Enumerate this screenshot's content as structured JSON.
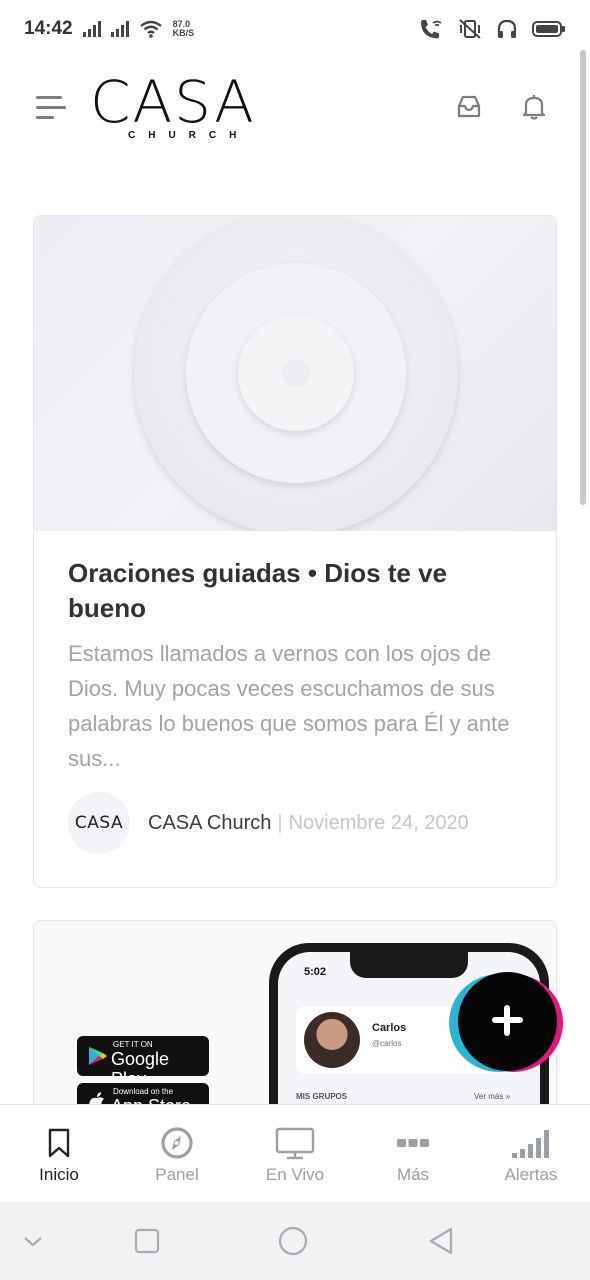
{
  "status_bar": {
    "time": "14:42",
    "net_speed_value": "87.0",
    "net_speed_unit": "KB/S"
  },
  "header": {
    "logo_main": "CASA",
    "logo_sub": "CHURCH",
    "menu_icon": "menu-icon",
    "inbox_icon": "inbox-icon",
    "notifications_icon": "bell-icon"
  },
  "feed": {
    "post": {
      "title": "Oraciones guiadas • Dios te ve bueno",
      "excerpt": "Estamos llamados a vernos con los ojos de Dios. Muy pocas veces escuchamos de sus palabras lo buenos que somos para Él y ante sus...",
      "author_avatar_text": "CASA",
      "author": "CASA Church",
      "separator": "|",
      "date": "Noviembre 24, 2020"
    },
    "promo": {
      "google_play_small": "GET IT ON",
      "google_play_big": "Google Play",
      "app_store_small": "Download on the",
      "app_store_big": "App Store",
      "phone_time": "5:02",
      "profile_name": "Carlos",
      "profile_handle": "@carlos",
      "groups_label": "MIS GRUPOS",
      "more_label": "Ver más »"
    }
  },
  "fab": {
    "icon": "plus-icon"
  },
  "tabbar": {
    "tabs": [
      {
        "label": "Inicio",
        "icon": "bookmark-icon",
        "active": true
      },
      {
        "label": "Panel",
        "icon": "compass-icon",
        "active": false
      },
      {
        "label": "En Vivo",
        "icon": "monitor-icon",
        "active": false
      },
      {
        "label": "Más",
        "icon": "more-dots-icon",
        "active": false
      },
      {
        "label": "Alertas",
        "icon": "signal-bars-icon",
        "active": false
      }
    ]
  },
  "system_nav": {
    "hide": "chevron-down-icon",
    "recents": "square-icon",
    "home": "circle-icon",
    "back": "triangle-back-icon"
  },
  "colors": {
    "fab_black": "#050505",
    "fab_pink": "#e6157e",
    "fab_cyan": "#27b7d3",
    "title_text": "#2f3237",
    "muted_text": "#a0a3a8",
    "tab_inactive": "#9aa0a6"
  }
}
